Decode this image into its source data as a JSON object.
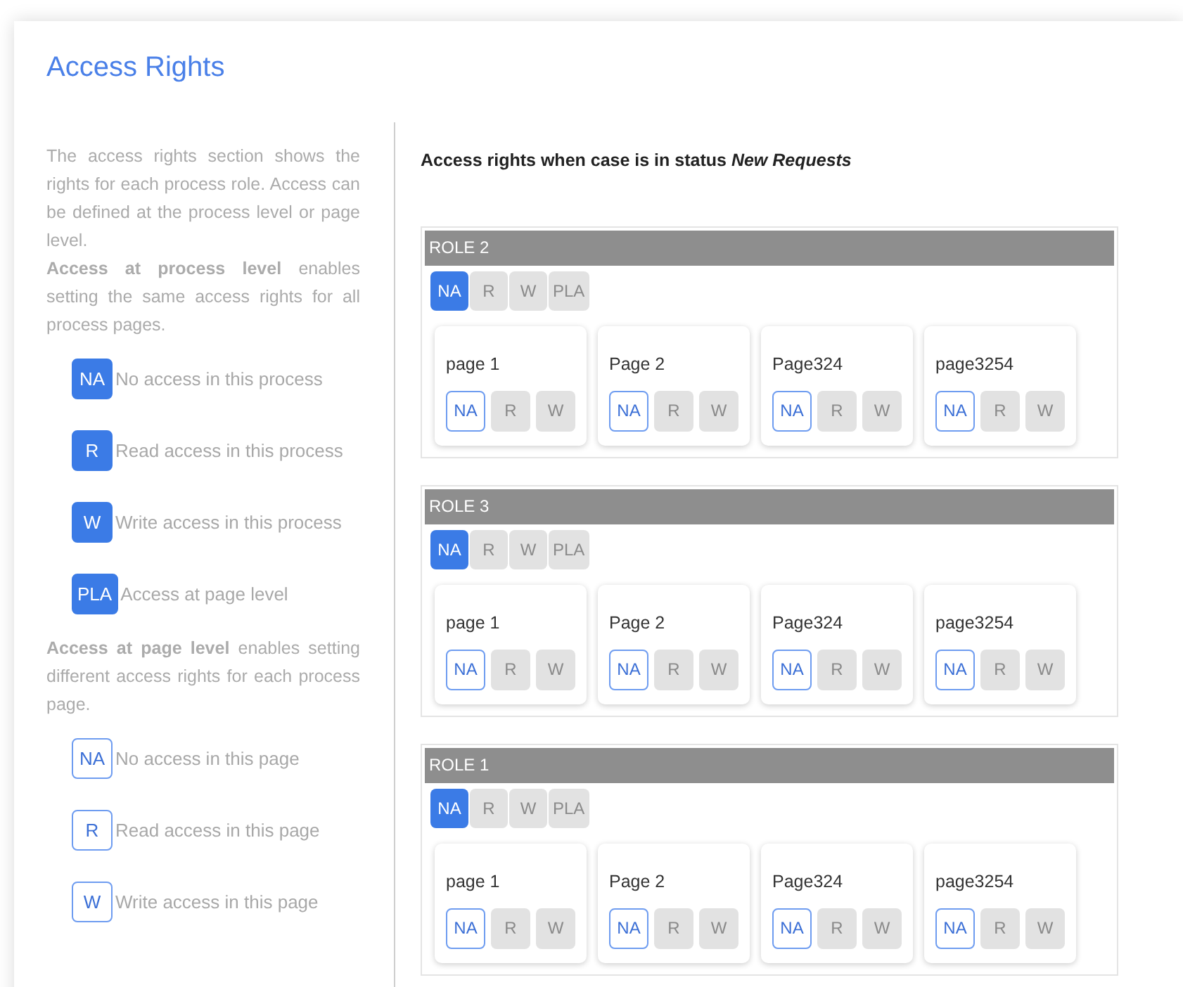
{
  "title": "Access Rights",
  "intro": "The access rights section shows the rights for each process role. Access can be defined at the process level or page level.",
  "process_text": "**Access at process level** enables setting the same access rights for all process pages.",
  "process_legend": [
    {
      "kind": "process",
      "badge": "NA",
      "label": "No access in this process"
    },
    {
      "kind": "process",
      "badge": "R",
      "label": "Read access in this process"
    },
    {
      "kind": "process",
      "badge": "W",
      "label": "Write access in this process"
    },
    {
      "kind": "process",
      "badge": "PLA",
      "label": "Access at page level"
    }
  ],
  "page_text": "**Access at page level** enables setting different access rights for each process page.",
  "page_legend": [
    {
      "kind": "page",
      "badge": "NA",
      "label": "No access in this page"
    },
    {
      "kind": "page",
      "badge": "R",
      "label": "Read access in this page"
    },
    {
      "kind": "page",
      "badge": "W",
      "label": "Write access in this page"
    }
  ],
  "heading": "Access rights when case is in status *New Requests*",
  "roles": [
    {
      "name": "ROLE 2",
      "process_buttons": [
        {
          "label": "NA",
          "selected": true
        },
        {
          "label": "R",
          "selected": false
        },
        {
          "label": "W",
          "selected": false
        },
        {
          "label": "PLA",
          "selected": false
        }
      ],
      "pages": [
        {
          "name": "page 1",
          "buttons": [
            {
              "label": "NA",
              "selected": true
            },
            {
              "label": "R",
              "selected": false
            },
            {
              "label": "W",
              "selected": false
            }
          ]
        },
        {
          "name": "Page 2",
          "buttons": [
            {
              "label": "NA",
              "selected": true
            },
            {
              "label": "R",
              "selected": false
            },
            {
              "label": "W",
              "selected": false
            }
          ]
        },
        {
          "name": "Page324",
          "buttons": [
            {
              "label": "NA",
              "selected": true
            },
            {
              "label": "R",
              "selected": false
            },
            {
              "label": "W",
              "selected": false
            }
          ]
        },
        {
          "name": "page3254",
          "buttons": [
            {
              "label": "NA",
              "selected": true
            },
            {
              "label": "R",
              "selected": false
            },
            {
              "label": "W",
              "selected": false
            }
          ]
        }
      ]
    },
    {
      "name": "ROLE 3",
      "process_buttons": [
        {
          "label": "NA",
          "selected": true
        },
        {
          "label": "R",
          "selected": false
        },
        {
          "label": "W",
          "selected": false
        },
        {
          "label": "PLA",
          "selected": false
        }
      ],
      "pages": [
        {
          "name": "page 1",
          "buttons": [
            {
              "label": "NA",
              "selected": true
            },
            {
              "label": "R",
              "selected": false
            },
            {
              "label": "W",
              "selected": false
            }
          ]
        },
        {
          "name": "Page 2",
          "buttons": [
            {
              "label": "NA",
              "selected": true
            },
            {
              "label": "R",
              "selected": false
            },
            {
              "label": "W",
              "selected": false
            }
          ]
        },
        {
          "name": "Page324",
          "buttons": [
            {
              "label": "NA",
              "selected": true
            },
            {
              "label": "R",
              "selected": false
            },
            {
              "label": "W",
              "selected": false
            }
          ]
        },
        {
          "name": "page3254",
          "buttons": [
            {
              "label": "NA",
              "selected": true
            },
            {
              "label": "R",
              "selected": false
            },
            {
              "label": "W",
              "selected": false
            }
          ]
        }
      ]
    },
    {
      "name": "ROLE 1",
      "process_buttons": [
        {
          "label": "NA",
          "selected": true
        },
        {
          "label": "R",
          "selected": false
        },
        {
          "label": "W",
          "selected": false
        },
        {
          "label": "PLA",
          "selected": false
        }
      ],
      "pages": [
        {
          "name": "page 1",
          "buttons": [
            {
              "label": "NA",
              "selected": true
            },
            {
              "label": "R",
              "selected": false
            },
            {
              "label": "W",
              "selected": false
            }
          ]
        },
        {
          "name": "Page 2",
          "buttons": [
            {
              "label": "NA",
              "selected": true
            },
            {
              "label": "R",
              "selected": false
            },
            {
              "label": "W",
              "selected": false
            }
          ]
        },
        {
          "name": "Page324",
          "buttons": [
            {
              "label": "NA",
              "selected": true
            },
            {
              "label": "R",
              "selected": false
            },
            {
              "label": "W",
              "selected": false
            }
          ]
        },
        {
          "name": "page3254",
          "buttons": [
            {
              "label": "NA",
              "selected": true
            },
            {
              "label": "R",
              "selected": false
            },
            {
              "label": "W",
              "selected": false
            }
          ]
        }
      ]
    }
  ]
}
